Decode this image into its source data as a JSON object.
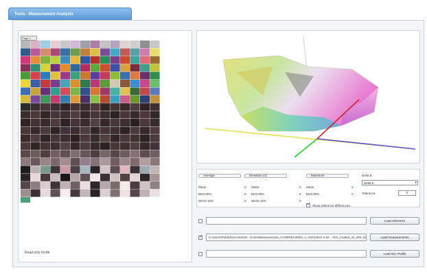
{
  "window": {
    "title": "Tools - Measurement Analysis"
  },
  "left": {
    "page_tab": "Page 1",
    "status": "Read only mode"
  },
  "colors": {
    "rows": [
      [
        "#b8b8b8",
        "#d6b4c6",
        "#9bd0e6",
        "#e7ccd6",
        "#c9c9c9",
        "#d1b8d8",
        "#9fa2a8",
        "#ad7ea9",
        "#c4c4c4",
        "#b5a4c2",
        "#e0d4d0",
        "#cfcfcf",
        "#8f8f8f",
        "#c8c8c8"
      ],
      [
        "#2f5a8a",
        "#b75a96",
        "#d38d6b",
        "#a84a72",
        "#3b6fa6",
        "#6d9b4b",
        "#c07f3d",
        "#d6c04a",
        "#7b4d99",
        "#47a9c8",
        "#c45a5a",
        "#5a9ea6",
        "#d27bae",
        "#e6dc6f"
      ],
      [
        "#d2367a",
        "#e78e3a",
        "#7fb33d",
        "#c0cf3f",
        "#3a8cbc",
        "#e8b43c",
        "#2a56a2",
        "#b3312b",
        "#2b8e5a",
        "#7c3e8b",
        "#d1472b",
        "#3aa6a0",
        "#e26a7b",
        "#9c6b2d"
      ],
      [
        "#8a2e5a",
        "#2f8e73",
        "#d7d43a",
        "#6a2f7f",
        "#e28a2c",
        "#2d6a9e",
        "#b22b5e",
        "#5aa73a",
        "#cf4c2c",
        "#3c4fa6",
        "#d9a13b",
        "#7b2b3e",
        "#3e9e8c",
        "#c0c23b"
      ],
      [
        "#4a9c3b",
        "#d63f4c",
        "#2b7cbf",
        "#e0c33a",
        "#9b3a8c",
        "#3aa07e",
        "#d0762c",
        "#5a3f9a",
        "#c33a5c",
        "#8fbf3a",
        "#3a6fb0",
        "#e07a3c",
        "#6a2f6a",
        "#2f8f4f"
      ],
      [
        "#e8d63a",
        "#3a5ea8",
        "#c53a3a",
        "#7a3f8f",
        "#4aa7b8",
        "#d98f2c",
        "#2d7a4a",
        "#b83a7a",
        "#5b9b3a",
        "#d3c8b0",
        "#8a5a3a",
        "#3a8fd0",
        "#c94a8a",
        "#6abf6a"
      ],
      [
        "#3e6fb4",
        "#c8a23a",
        "#6a2f7a",
        "#2f9f8f",
        "#d84a5a",
        "#7bb54a",
        "#2f4f8f",
        "#d6762f",
        "#9a3a6a",
        "#4ab0a0",
        "#e0c050",
        "#3a6a3a",
        "#c04a4a",
        "#5a7ac0"
      ],
      [
        "#d6b83a",
        "#7a4a9a",
        "#3a9a5a",
        "#c83a6a",
        "#2f7fb0",
        "#e09a3a",
        "#4a2f6a",
        "#8ac04a",
        "#b84a2f",
        "#3aa0c0",
        "#d05a8a",
        "#6a9a2f",
        "#2f3f7a",
        "#c0903a"
      ],
      [
        "#2a2a2a",
        "#3a2f30",
        "#4a3638",
        "#3d2c32",
        "#2c2426",
        "#463234",
        "#3b2b2e",
        "#4c383a",
        "#302628",
        "#433134",
        "#382a2c",
        "#4f3b3d",
        "#2e2325",
        "#413033"
      ],
      [
        "#3a2c2e",
        "#4b3739",
        "#2f2527",
        "#45333a",
        "#3c2d30",
        "#503c3f",
        "#332729",
        "#473538",
        "#3e2e31",
        "#2b2224",
        "#4a3638",
        "#36292b",
        "#4d393c",
        "#312628"
      ],
      [
        "#2e2426",
        "#433134",
        "#392b2d",
        "#4e3a3c",
        "#2c2325",
        "#45323a",
        "#3b2c2f",
        "#514042",
        "#342829",
        "#48363a",
        "#3f2f32",
        "#2a2022",
        "#4c383b",
        "#37292c"
      ],
      [
        "#473537",
        "#352829",
        "#4c393b",
        "#2d2325",
        "#42313a",
        "#3a2c2f",
        "#503d3f",
        "#312527",
        "#45343a",
        "#3d2e31",
        "#2c2224",
        "#4b3a3c",
        "#362a2c",
        "#4f3c3e"
      ],
      [
        "#392b2d",
        "#4e3b3d",
        "#302527",
        "#463538",
        "#3b2d30",
        "#2b2123",
        "#4a383a",
        "#372a2c",
        "#513f41",
        "#322628",
        "#48373a",
        "#3f3032",
        "#2d2325",
        "#4c393c"
      ],
      [
        "#4a393b",
        "#2f2426",
        "#443337",
        "#3c2e31",
        "#523f42",
        "#332729",
        "#4b3a3c",
        "#372a2d",
        "#2c2224",
        "#46363a",
        "#3e2f32",
        "#4f3d3f",
        "#342829",
        "#42323a"
      ],
      [
        "#5a4a4e",
        "#6b5a5e",
        "#4e3f42",
        "#735f63",
        "#5f4e52",
        "#816c70",
        "#665559",
        "#4b3d40",
        "#7a6569",
        "#574649",
        "#6e5c60",
        "#846f73",
        "#5c4b4f",
        "#705e62"
      ],
      [
        "#8d7a7e",
        "#6a585c",
        "#9a8589",
        "#7a676b",
        "#a18c90",
        "#5f4e52",
        "#93808a",
        "#857276",
        "#ab989c",
        "#6f5d61",
        "#9c888c",
        "#7e6b6f",
        "#b19ea2",
        "#8a777b"
      ],
      [
        "#1f1a1c",
        "#bdb0b3",
        "#7a9a8a",
        "#3e3537",
        "#c89ba6",
        "#4a4046",
        "#a6b7c0",
        "#2a2426",
        "#d6c3c7",
        "#5b4c52",
        "#e2b7c3",
        "#3a3234",
        "#9fa8b0",
        "#c2b3b6"
      ],
      [
        "#2b2527",
        "#e8d8dc",
        "#463a3e",
        "#c9bcc0",
        "#1c1719",
        "#b7a6aa",
        "#5d4f53",
        "#f0e6e8",
        "#3a3033",
        "#d1c2c6",
        "#4f4245",
        "#e4d3d7",
        "#2e2729",
        "#a69599"
      ],
      [
        "#54464a",
        "#8b7c80",
        "#d8cbcf",
        "#3f3437",
        "#c0b1b5",
        "#6e6064",
        "#e9dde0",
        "#2d2629",
        "#b5a7ab",
        "#7a6b6f",
        "#f2e9eb",
        "#493c40",
        "#cfc1c5",
        "#8f8084"
      ],
      [
        "#9d8e92",
        "#3a3135",
        "#e6d9dd",
        "#5f5155",
        "#f5edef",
        "#463a3e",
        "#c4b6ba",
        "#2b2427",
        "#dccfd3",
        "#7f7074",
        "#eee4e6",
        "#54474b",
        "#bfb0b4",
        "#eae0e2"
      ]
    ],
    "extra": [
      "#4aa07a"
    ]
  },
  "chart": {},
  "stats": {
    "groups": [
      {
        "label": "Average",
        "rows": [
          {
            "k": "Mean",
            "v": "0"
          },
          {
            "k": "Best 90%",
            "v": "0"
          },
          {
            "k": "Worst 10%",
            "v": "0"
          }
        ]
      },
      {
        "label": "Deviation (σ)",
        "rows": [
          {
            "k": "Mean",
            "v": "0"
          },
          {
            "k": "Best 90%",
            "v": "0"
          },
          {
            "k": "Worst 10%",
            "v": "0"
          }
        ]
      },
      {
        "label": "Maximum",
        "rows": [
          {
            "k": "Mean",
            "v": "0"
          },
          {
            "k": "Best 90%",
            "v": "0"
          }
        ]
      }
    ],
    "delta": {
      "label": "Delta E",
      "select": "Delta E",
      "tolerance_label": "Tolerance",
      "tolerance_value": "0"
    },
    "show_ref_label": "Show reference differences"
  },
  "files": {
    "reference": {
      "value": "",
      "button": "Load reference"
    },
    "measurement": {
      "value": "C:\\Users\\Public\\Documents\\...\\ColorMeasurements_CCWR\\ECI2002_V_ISO12647-2.txt    ...ISO_Coated_v2_300_bas",
      "button": "Load measurements"
    },
    "icc": {
      "value": "",
      "button": "Load ICC Profile"
    }
  }
}
